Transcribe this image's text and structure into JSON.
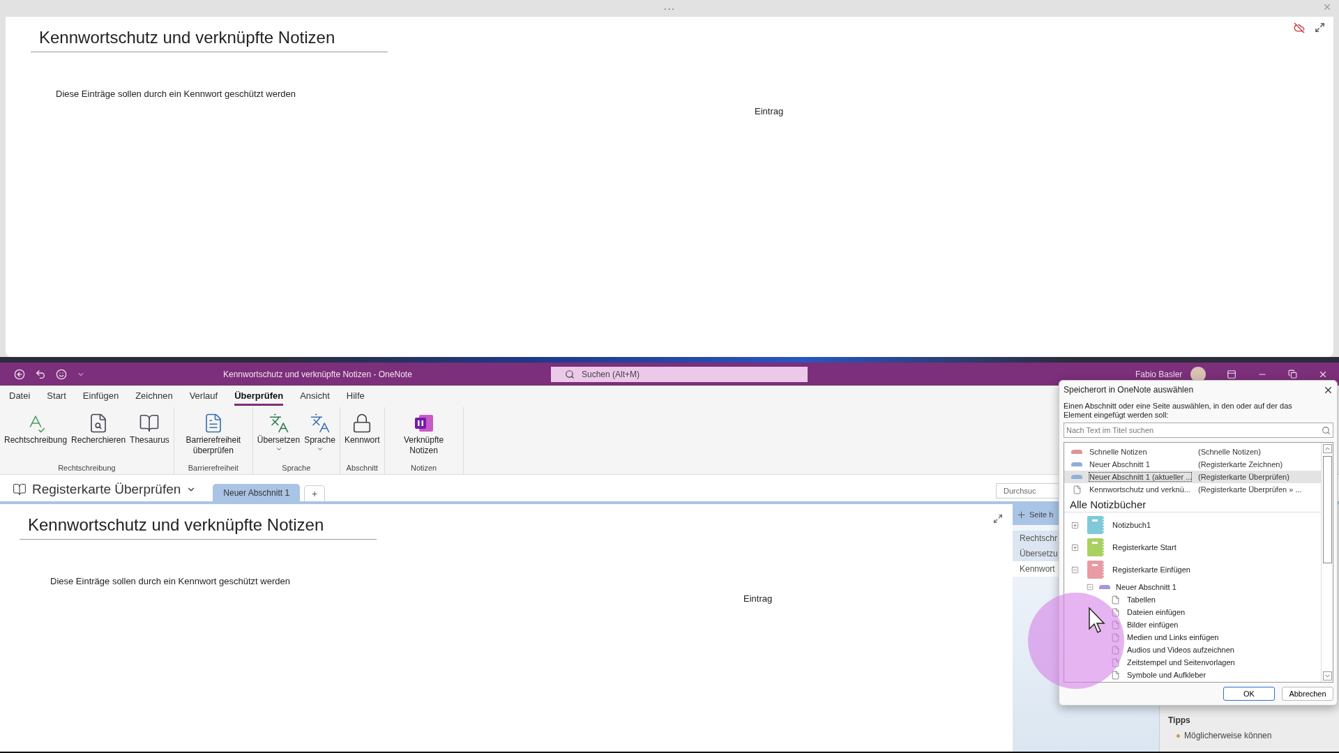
{
  "linked_window": {
    "dots": "···",
    "title": "Kennwortschutz und verknüpfte Notizen",
    "body": "Diese Einträge sollen durch ein Kennwort geschützt werden",
    "entry": "Eintrag"
  },
  "titlebar": {
    "title": "Kennwortschutz und verknüpfte Notizen  -  OneNote",
    "search_placeholder": "Suchen (Alt+M)",
    "user": "Fabio Basler"
  },
  "menu_tabs": [
    {
      "label": "Datei",
      "selected": false
    },
    {
      "label": "Start",
      "selected": false
    },
    {
      "label": "Einfügen",
      "selected": false
    },
    {
      "label": "Zeichnen",
      "selected": false
    },
    {
      "label": "Verlauf",
      "selected": false
    },
    {
      "label": "Überprüfen",
      "selected": true
    },
    {
      "label": "Ansicht",
      "selected": false
    },
    {
      "label": "Hilfe",
      "selected": false
    }
  ],
  "ribbon_groups": [
    {
      "label": "Rechtschreibung",
      "buttons": [
        {
          "kind": "spelling",
          "label": "Rechtschreibung",
          "dropdown": false
        },
        {
          "kind": "research",
          "label": "Recherchieren",
          "dropdown": false
        },
        {
          "kind": "thesaurus",
          "label": "Thesaurus",
          "dropdown": false
        }
      ]
    },
    {
      "label": "Barrierefreiheit",
      "buttons": [
        {
          "kind": "accessibility",
          "label": "Barrierefreiheit überprüfen",
          "dropdown": false
        }
      ]
    },
    {
      "label": "Sprache",
      "buttons": [
        {
          "kind": "translate",
          "label": "Übersetzen",
          "dropdown": true
        },
        {
          "kind": "language",
          "label": "Sprache",
          "dropdown": true
        }
      ]
    },
    {
      "label": "Abschnitt",
      "buttons": [
        {
          "kind": "password",
          "label": "Kennwort",
          "dropdown": false
        }
      ]
    },
    {
      "label": "Notizen",
      "buttons": [
        {
          "kind": "linked",
          "label": "Verknüpfte Notizen",
          "dropdown": false
        }
      ]
    }
  ],
  "notebook_picker": {
    "name": "Registerkarte Überprüfen"
  },
  "section_tabs": [
    {
      "label": "Neuer Abschnitt 1",
      "selected": true
    }
  ],
  "add_section": "+",
  "page": {
    "title": "Kennwortschutz und verknüpfte Notizen",
    "body": "Diese Einträge sollen durch ein Kennwort geschützt werden",
    "entry": "Eintrag"
  },
  "side_pane": {
    "search_placeholder": "Durchsuc",
    "add_page": "Seite h",
    "pages": [
      {
        "title": "Rechtschr",
        "selected": false
      },
      {
        "title": "Übersetzu",
        "selected": false
      },
      {
        "title": "Kennwort",
        "selected": true
      }
    ]
  },
  "tips": {
    "heading": "Tipps",
    "items": [
      "Möglicherweise können"
    ]
  },
  "dialog": {
    "title": "Speicherort in OneNote auswählen",
    "description": "Einen Abschnitt oder eine Seite auswählen, in den oder auf der das Element eingefügt werden soll:",
    "search_placeholder": "Nach Text im Titel suchen",
    "recent": [
      {
        "kind": "section",
        "name": "Schnelle Notizen",
        "location": "(Schnelle Notizen)",
        "color": "#e3919c",
        "selected": false
      },
      {
        "kind": "section",
        "name": "Neuer Abschnitt 1",
        "location": "(Registerkarte Zeichnen)",
        "color": "#8fb0d9",
        "selected": false
      },
      {
        "kind": "section",
        "name": "Neuer Abschnitt 1 (aktueller ...",
        "location": "(Registerkarte Überprüfen)",
        "color": "#8fb0d9",
        "selected": true
      },
      {
        "kind": "page",
        "name": "Kennwortschutz und verknü...",
        "location": "(Registerkarte Überprüfen » ...",
        "selected": false
      }
    ],
    "all_heading": "Alle Notizbücher",
    "notebooks": [
      {
        "name": "Notizbuch1",
        "color": "#7fc9d9",
        "expanded": false
      },
      {
        "name": "Registerkarte Start",
        "color": "#a9d162",
        "expanded": false
      },
      {
        "name": "Registerkarte Einfügen",
        "color": "#e99aa2",
        "expanded": true,
        "sections": [
          {
            "name": "Neuer Abschnitt 1",
            "color": "#a995d9",
            "expanded": true,
            "pages": [
              "Tabellen",
              "Dateien einfügen",
              "Bilder einfügen",
              "Medien und Links einfügen",
              "Audios und Videos aufzeichnen",
              "Zeitstempel und Seitenvorlagen",
              "Symbole und Aufkleber"
            ]
          }
        ]
      }
    ],
    "buttons": [
      {
        "label": "OK",
        "default": true
      },
      {
        "label": "Abbrechen",
        "default": false
      }
    ]
  }
}
